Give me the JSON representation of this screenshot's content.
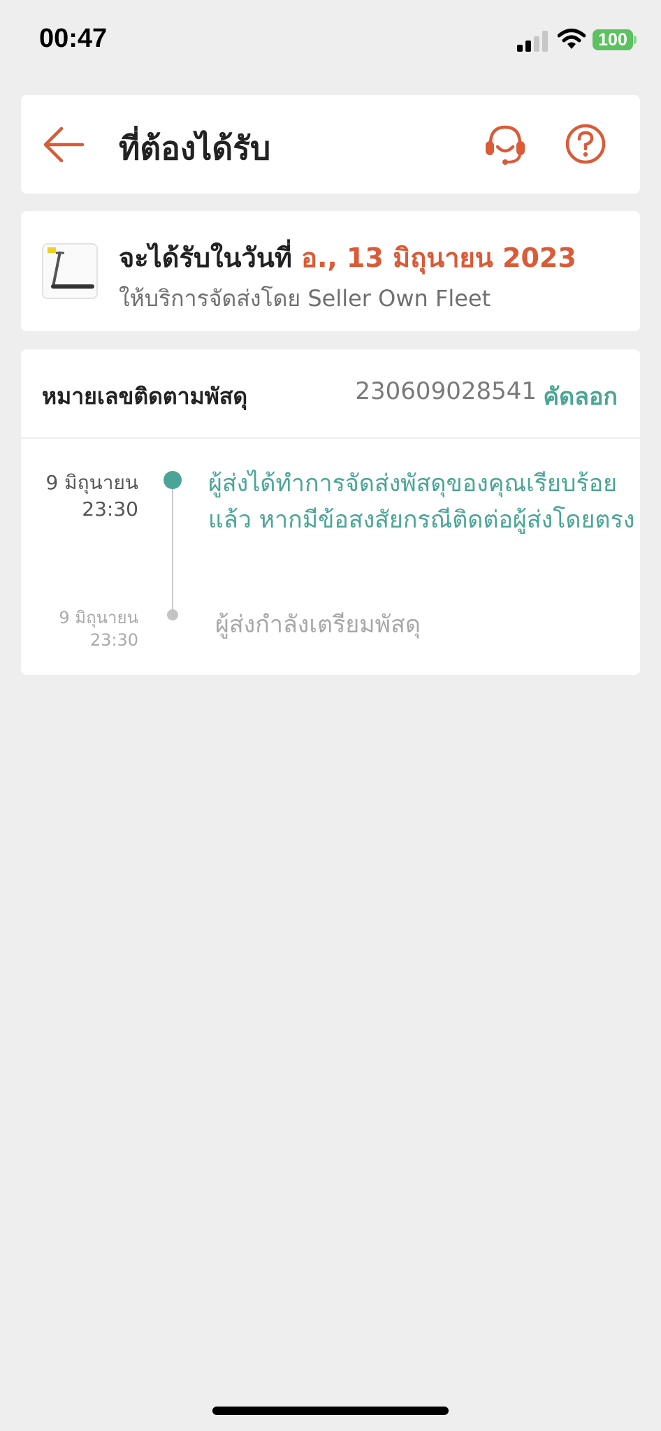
{
  "status_bar": {
    "time": "00:47",
    "battery": "100"
  },
  "header": {
    "title": "ที่ต้องได้รับ"
  },
  "delivery": {
    "label_prefix": "จะได้รับในวันที่",
    "date": "อ., 13 มิถุนายน 2023",
    "carrier": "ให้บริการจัดส่งโดย Seller Own Fleet"
  },
  "tracking": {
    "label": "หมายเลขติดตามพัสดุ",
    "number": "230609028541",
    "copy_label": "คัดลอก",
    "events": [
      {
        "date": "9 มิถุนายน",
        "time": "23:30",
        "description": "ผู้ส่งได้ทำการจัดส่งพัสดุของคุณเรียบร้อยแล้ว หากมีข้อสงสัยกรณีติดต่อผู้ส่งโดยตรง"
      },
      {
        "date": "9 มิถุนายน",
        "time": "23:30",
        "description": "ผู้ส่งกำลังเตรียมพัสดุ"
      }
    ]
  },
  "colors": {
    "accent_orange": "#d95b37",
    "accent_teal": "#4aa596",
    "background": "#eeeeee"
  },
  "icons": {
    "back": "arrow-left-icon",
    "support": "headset-icon",
    "help": "question-circle-icon"
  }
}
